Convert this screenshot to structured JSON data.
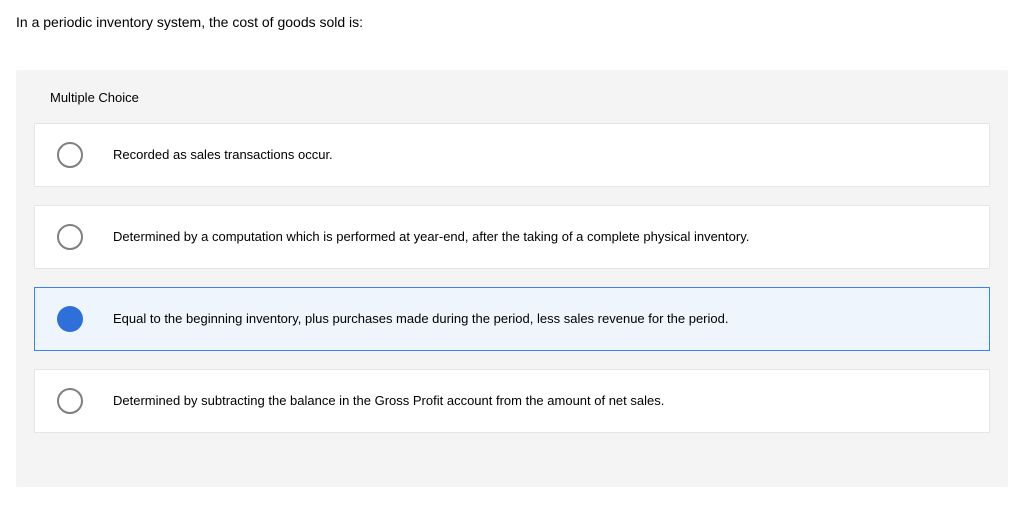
{
  "question": "In a periodic inventory system, the cost of goods sold is:",
  "section_label": "Multiple Choice",
  "options": [
    {
      "text": "Recorded as sales transactions occur.",
      "selected": false
    },
    {
      "text": "Determined by a computation which is performed at year-end, after the taking of a complete physical inventory.",
      "selected": false
    },
    {
      "text": "Equal to the beginning inventory, plus purchases made during the period, less sales revenue for the period.",
      "selected": true
    },
    {
      "text": "Determined by subtracting the balance in the Gross Profit account from the amount of net sales.",
      "selected": false
    }
  ]
}
